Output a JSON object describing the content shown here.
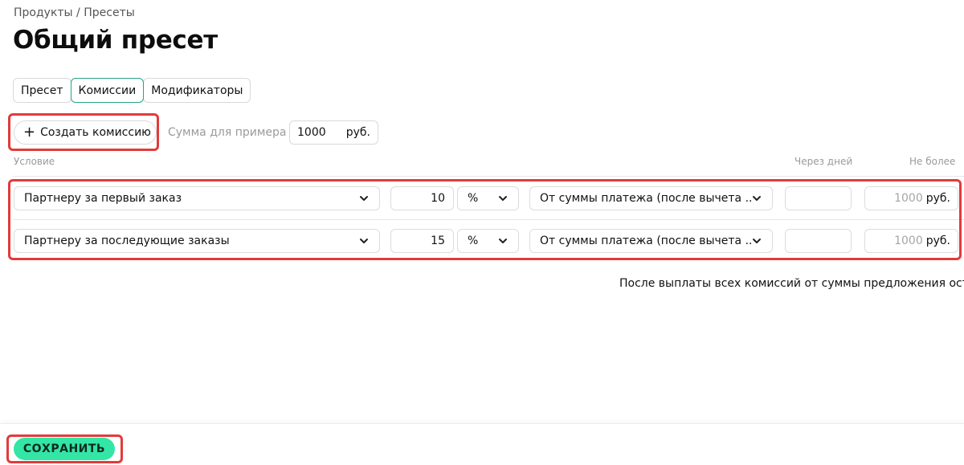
{
  "breadcrumb": "Продукты / Пресеты",
  "title": "Общий пресет",
  "tabs": [
    {
      "label": "Пресет",
      "active": false
    },
    {
      "label": "Комиссии",
      "active": true
    },
    {
      "label": "Модификаторы",
      "active": false
    }
  ],
  "create_button": {
    "icon": "plus-icon",
    "label": "Создать комиссию"
  },
  "sample": {
    "label": "Сумма для примера",
    "value": "1000",
    "unit": "руб."
  },
  "columns": {
    "condition": "Условие",
    "days": "Через дней",
    "limit": "Не более"
  },
  "rows": [
    {
      "condition": "Партнеру за первый заказ",
      "value": "10",
      "unit": "%",
      "base": "От суммы платежа (после вычета ...",
      "days": "",
      "limit_placeholder": "1000",
      "limit_unit": "руб."
    },
    {
      "condition": "Партнеру за последующие заказы",
      "value": "15",
      "unit": "%",
      "base": "От суммы платежа (после вычета ...",
      "days": "",
      "limit_placeholder": "1000",
      "limit_unit": "руб."
    }
  ],
  "summary": "После выплаты всех комиссий от суммы предложения оста",
  "save_button": "СОХРАНИТЬ",
  "colors": {
    "accent": "#27a38a",
    "save": "#33e6a6",
    "highlight": "#e23b3b"
  }
}
